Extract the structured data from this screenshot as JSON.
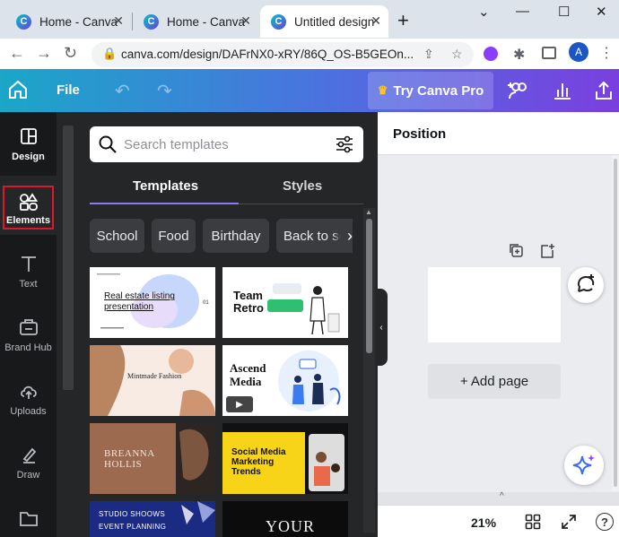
{
  "browser": {
    "tabs": [
      {
        "title": "Home - Canva",
        "active": false
      },
      {
        "title": "Home - Canva",
        "active": false
      },
      {
        "title": "Untitled design",
        "active": true
      }
    ],
    "url": "canva.com/design/DAFrNX0-xRY/86Q_OS-B5GEOn...",
    "profile_initial": "A",
    "colors": {
      "strip": "#dde3ea",
      "avatar": "#1a56c4"
    }
  },
  "canva_header": {
    "file_label": "File",
    "try_pro_label": "Try Canva Pro",
    "icons": [
      "home-icon",
      "undo-icon",
      "redo-icon",
      "crown-icon",
      "add-people-icon",
      "insights-icon",
      "share-icon"
    ]
  },
  "sidebar": {
    "items": [
      {
        "label": "Design",
        "icon": "design-icon"
      },
      {
        "label": "Elements",
        "icon": "elements-icon",
        "selected": true
      },
      {
        "label": "Text",
        "icon": "text-icon"
      },
      {
        "label": "Brand Hub",
        "icon": "brand-hub-icon"
      },
      {
        "label": "Uploads",
        "icon": "uploads-icon"
      },
      {
        "label": "Draw",
        "icon": "draw-icon"
      }
    ],
    "highlight_color": "#e0162b"
  },
  "panel": {
    "search_placeholder": "Search templates",
    "tabs": [
      {
        "label": "Templates",
        "active": true
      },
      {
        "label": "Styles",
        "active": false
      }
    ],
    "chips": [
      "School",
      "Food",
      "Birthday",
      "Back to sc"
    ],
    "templates": [
      {
        "text": "Real estate listing presentation",
        "small": "01"
      },
      {
        "text": "Team Retro"
      },
      {
        "text": "Mintmade Fashion"
      },
      {
        "text": "Ascend Media"
      },
      {
        "text": "BREANNA HOLLIS"
      },
      {
        "text": "Social Media Marketing Trends"
      },
      {
        "text": "STUDIO SHOOWS EVENT PLANNING"
      },
      {
        "text": "YOUR"
      }
    ]
  },
  "canvas": {
    "header_title": "Position",
    "add_page_label": "+ Add page",
    "zoom": "21%",
    "help": "?",
    "accent": "#8b3dff"
  }
}
